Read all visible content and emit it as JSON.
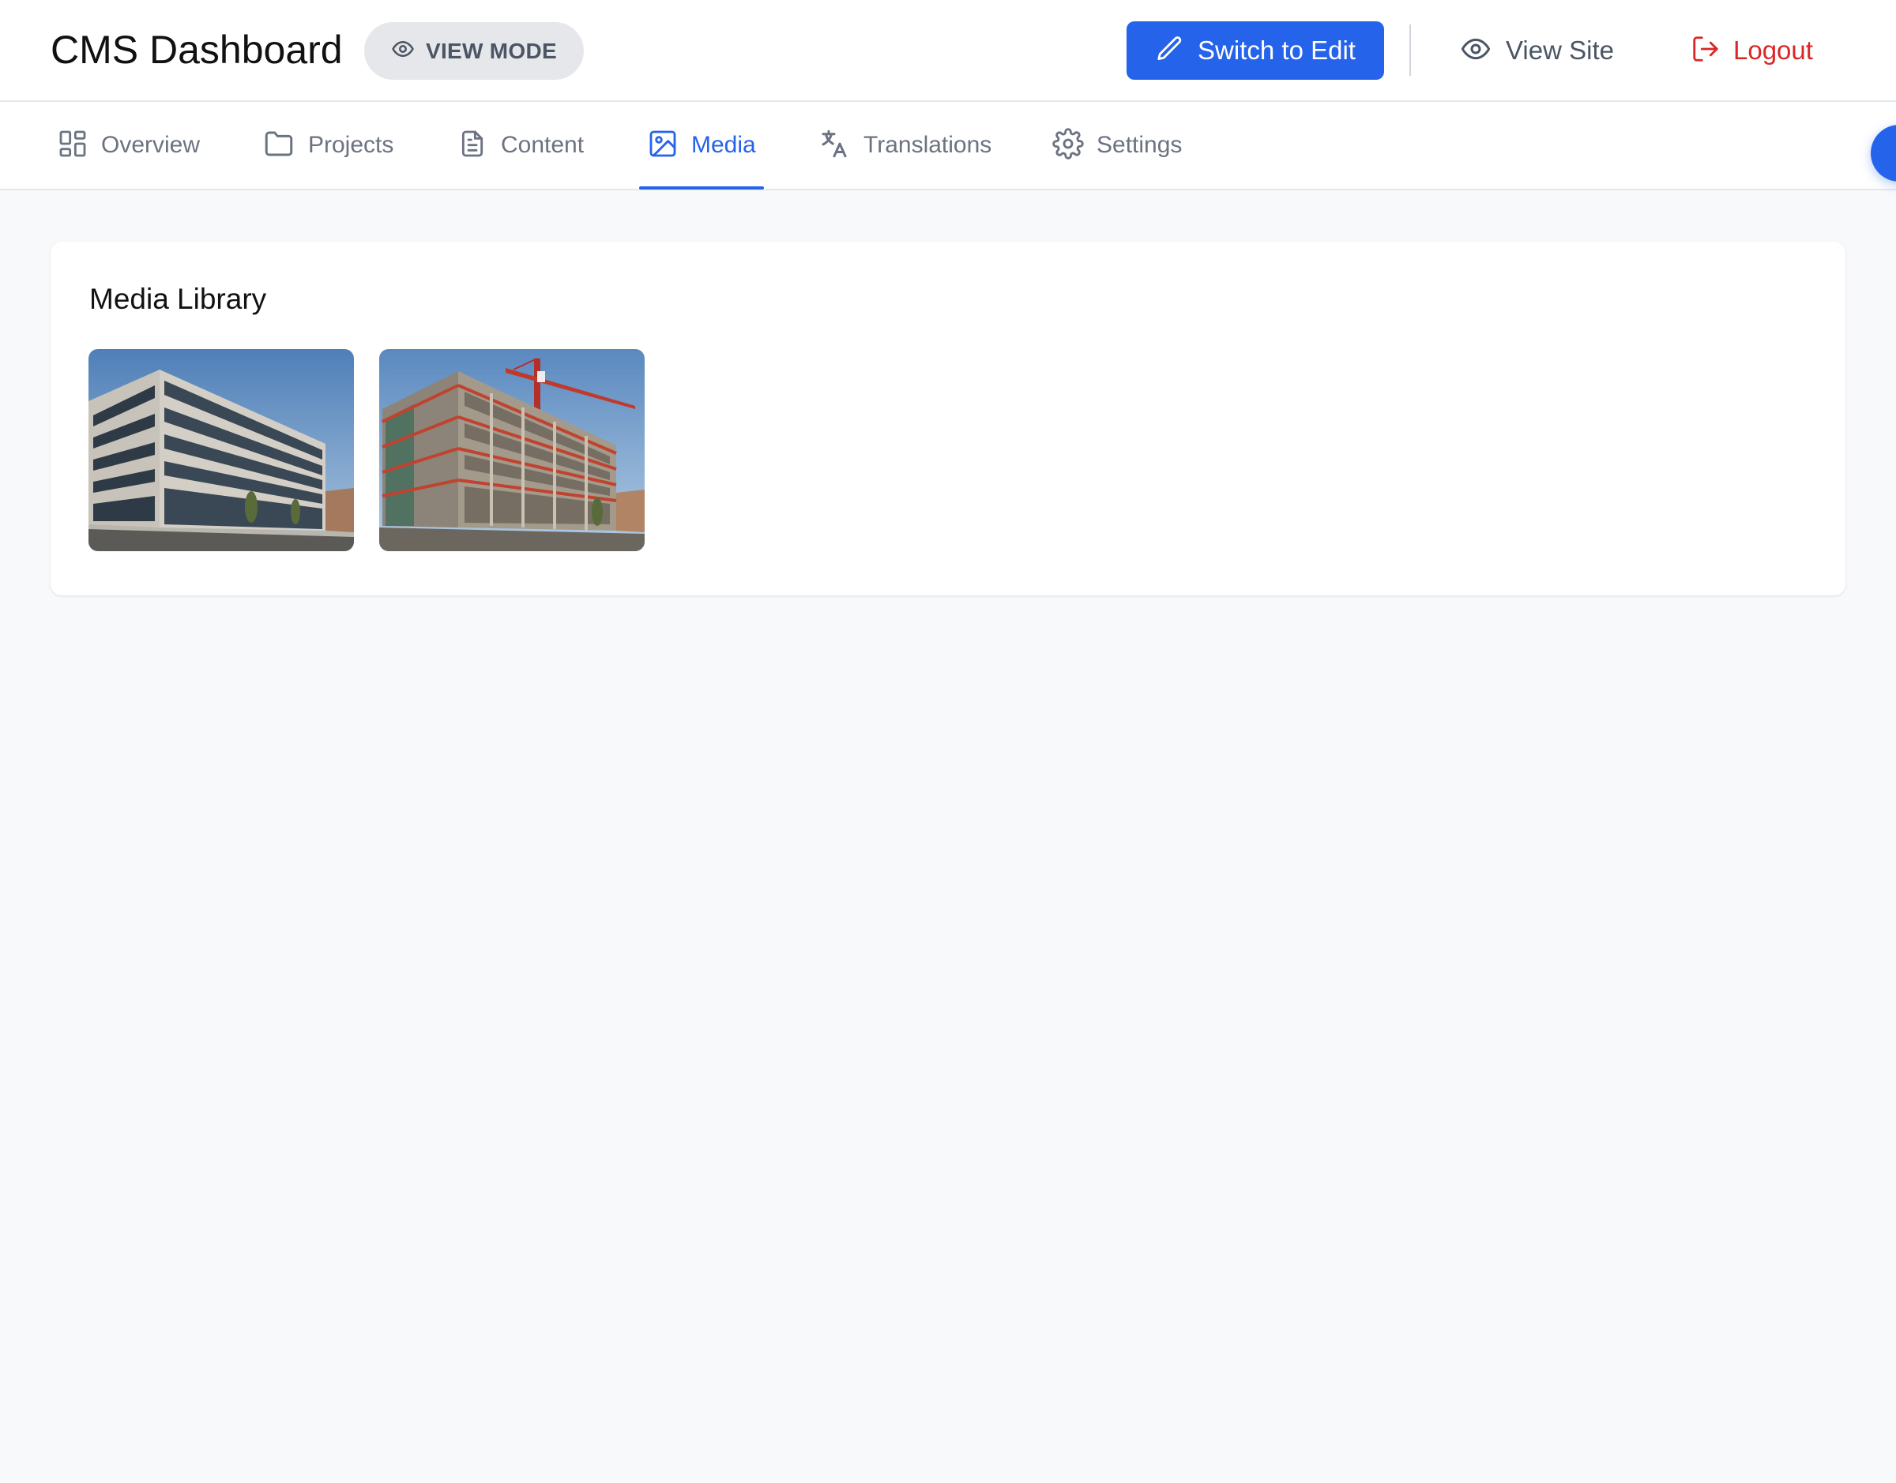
{
  "header": {
    "title": "CMS Dashboard",
    "mode_badge": "VIEW MODE",
    "switch_button": "Switch to Edit",
    "view_site": "View Site",
    "logout": "Logout"
  },
  "tabs": [
    {
      "label": "Overview",
      "icon": "grid-icon",
      "active": false
    },
    {
      "label": "Projects",
      "icon": "folder-icon",
      "active": false
    },
    {
      "label": "Content",
      "icon": "document-icon",
      "active": false
    },
    {
      "label": "Media",
      "icon": "image-icon",
      "active": true
    },
    {
      "label": "Translations",
      "icon": "translate-icon",
      "active": false
    },
    {
      "label": "Settings",
      "icon": "gear-icon",
      "active": false
    }
  ],
  "media": {
    "title": "Media Library",
    "items": [
      {
        "subject": "office-building-photo"
      },
      {
        "subject": "construction-site-photo"
      }
    ]
  },
  "colors": {
    "accent": "#2563eb",
    "danger": "#dc2626",
    "muted_text": "#6b7280",
    "background": "#f8f9fb"
  }
}
